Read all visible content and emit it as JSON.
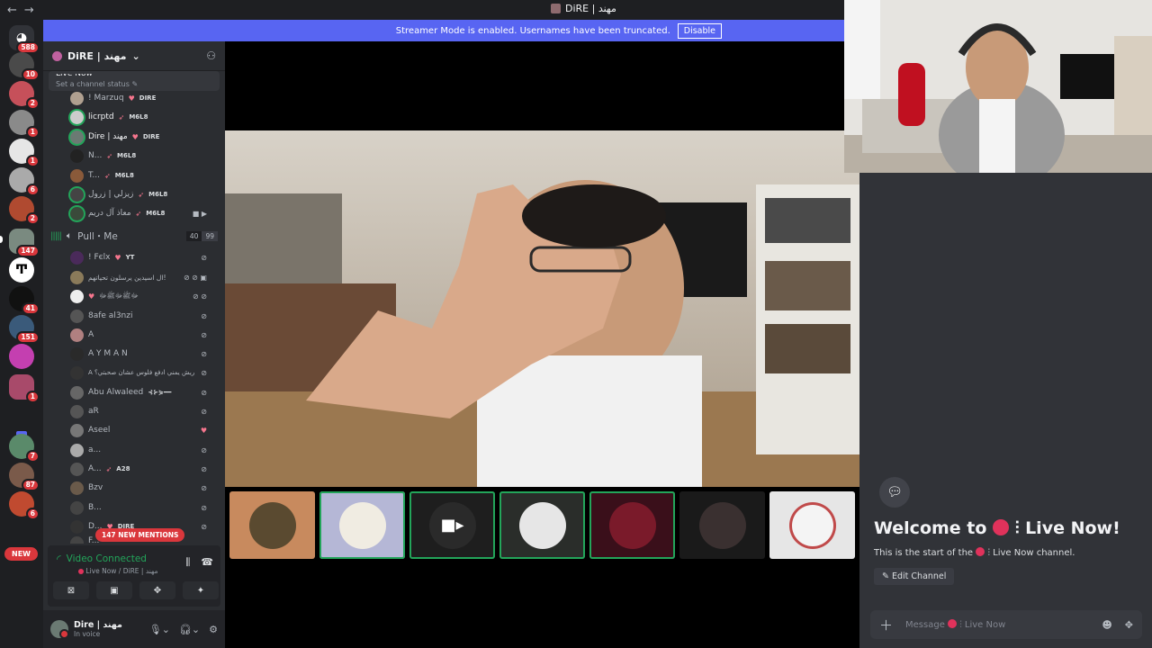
{
  "window": {
    "title": "DiRE | مهند"
  },
  "banner": {
    "text": "Streamer Mode is enabled. Usernames have been truncated.",
    "button": "Disable"
  },
  "servers": {
    "badges": [
      "588",
      "10",
      "2",
      "1",
      "1",
      "6",
      "2",
      "147",
      "41",
      "151",
      "1",
      "7",
      "87",
      "6"
    ],
    "new_label": "NEW"
  },
  "guild": {
    "name": "DiRE | مهند"
  },
  "channel_top": {
    "name": "Live Now",
    "status": "Set a channel status"
  },
  "live_members": [
    {
      "name": "! Marzuq",
      "tag": "DIRE",
      "icon": "heart"
    },
    {
      "name": "licrptd",
      "tag": "M6L8",
      "icon": "rocket"
    },
    {
      "name": "Dire | مهند",
      "tag": "DIRE",
      "icon": "heart"
    },
    {
      "name": "N...",
      "tag": "M6L8",
      "icon": "rocket"
    },
    {
      "name": "T...",
      "tag": "M6L8",
      "icon": "rocket"
    },
    {
      "name": "زيزلي | زرول",
      "tag": "M6L8",
      "icon": "rocket"
    },
    {
      "name": "معاذ آل دريم",
      "tag": "M6L8",
      "icon": "rocket"
    }
  ],
  "pull_channel": {
    "name": "Pull・Me",
    "count": "40",
    "limit": "99"
  },
  "pull_members": [
    {
      "name": "! Fєlх",
      "tag": "YT"
    },
    {
      "name": "ال اسيدين يرسلون تحياتهم!",
      "tag": ""
    },
    {
      "name": "ﷻﷺﷻﷺﷻ",
      "tag": ""
    },
    {
      "name": "8afe al3nzi",
      "tag": ""
    },
    {
      "name": "A",
      "tag": ""
    },
    {
      "name": "A Y M A N",
      "tag": ""
    },
    {
      "name": "A ریش يمني ادفع فلوس عشان صحبتي؟",
      "tag": ""
    },
    {
      "name": "Abu Alwaleed",
      "tag": "⊰⊱⋟━━"
    },
    {
      "name": "aR",
      "tag": ""
    },
    {
      "name": "Aseel",
      "tag": ""
    },
    {
      "name": "a...",
      "tag": ""
    },
    {
      "name": "A...",
      "tag": "A28"
    },
    {
      "name": "Bzv",
      "tag": ""
    },
    {
      "name": "B...",
      "tag": ""
    },
    {
      "name": "D...",
      "tag": "DIRE"
    },
    {
      "name": "F...",
      "tag": ""
    }
  ],
  "mentions_pill": "147 NEW MENTIONS",
  "voice_panel": {
    "status": "Video Connected",
    "channel": "Live Now / DiRE | مهند"
  },
  "user": {
    "name": "Dire | مهند",
    "status": "In voice"
  },
  "chat": {
    "welcome_prefix": "Welcome to",
    "channel_name": "Live Now!",
    "start_text": "This is the start of the",
    "start_suffix": "Live Now channel.",
    "edit_button": "Edit Channel",
    "composer_placeholder": "Message",
    "composer_channel": "Live Now"
  },
  "colors": {
    "accent": "#5865f2",
    "online": "#23a55a",
    "danger": "#da373c",
    "live_dot": "#e0325b"
  }
}
